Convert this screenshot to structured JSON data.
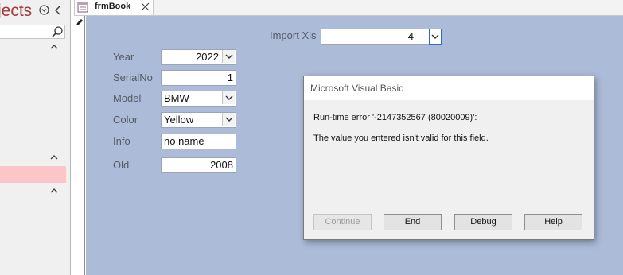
{
  "nav": {
    "title_fragment": "jects",
    "search_value": ""
  },
  "tab": {
    "label": "frmBook"
  },
  "form": {
    "import_label": "Import Xls",
    "import_value": "4",
    "fields": {
      "year_label": "Year",
      "year_value": "2022",
      "serial_label": "SerialNo",
      "serial_value": "1",
      "model_label": "Model",
      "model_value": "BMW",
      "color_label": "Color",
      "color_value": "Yellow",
      "info_label": "Info",
      "info_value": "no name",
      "old_label": "Old",
      "old_value": "2008"
    }
  },
  "dialog": {
    "title": "Microsoft Visual Basic",
    "message1": "Run-time error '-2147352567 (80020009)':",
    "message2": "The value you entered isn't valid for this field.",
    "buttons": {
      "continue": "Continue",
      "end": "End",
      "debug": "Debug",
      "help": "Help"
    }
  },
  "colors": {
    "form_background": "#acbcd8",
    "nav_title": "#a4373a",
    "nav_selected": "#fcc5c6"
  }
}
